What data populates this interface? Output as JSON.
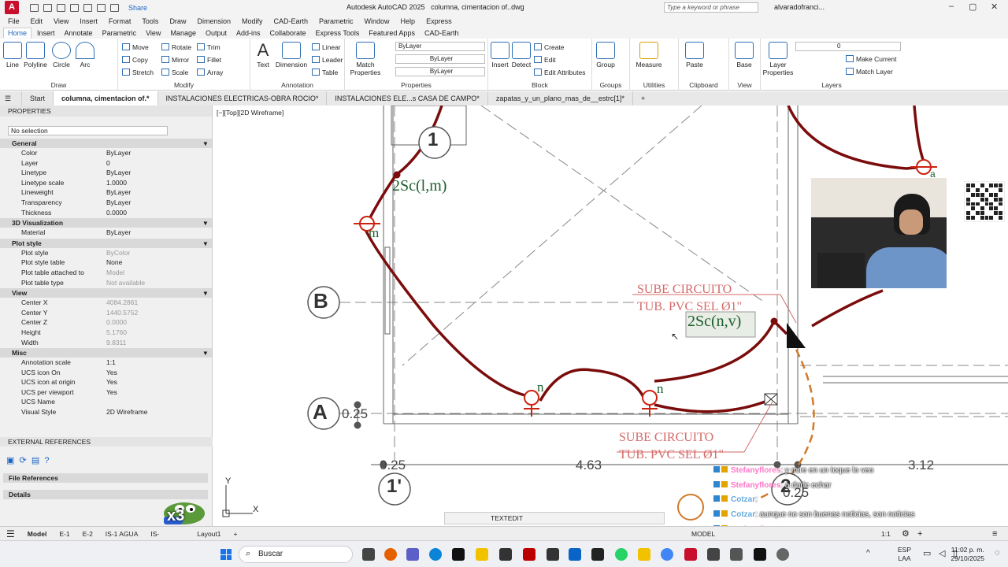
{
  "window": {
    "app_title": "Autodesk AutoCAD 2025",
    "file_title": "columna, cimentacion of..dwg",
    "search_placeholder": "Type a keyword or phrase",
    "user": "alvaradofranci...",
    "share": "Share"
  },
  "menu": [
    "File",
    "Edit",
    "View",
    "Insert",
    "Format",
    "Tools",
    "Draw",
    "Dimension",
    "Modify",
    "CAD-Earth",
    "Parametric",
    "Window",
    "Help",
    "Express"
  ],
  "ribbon_tabs": [
    "Home",
    "Insert",
    "Annotate",
    "Parametric",
    "View",
    "Manage",
    "Output",
    "Add-ins",
    "Collaborate",
    "Express Tools",
    "Featured Apps",
    "CAD-Earth"
  ],
  "active_ribbon_tab": "Home",
  "ribbon": {
    "draw": {
      "label": "Draw",
      "items": [
        "Line",
        "Polyline",
        "Circle",
        "Arc"
      ]
    },
    "modify": {
      "label": "Modify",
      "items": [
        "Move",
        "Rotate",
        "Trim",
        "Copy",
        "Mirror",
        "Fillet",
        "Stretch",
        "Scale",
        "Array"
      ]
    },
    "annotation": {
      "label": "Annotation",
      "items": [
        "Text",
        "Dimension",
        "Linear",
        "Leader",
        "Table"
      ]
    },
    "properties": {
      "label": "Properties",
      "match": "Match Properties",
      "dd1": "ByLayer",
      "dd2": "ByLayer",
      "dd3": "ByLayer"
    },
    "block": {
      "label": "Block",
      "items": [
        "Insert",
        "Detect",
        "Create",
        "Edit",
        "Edit Attributes"
      ]
    },
    "groups": {
      "label": "Groups",
      "item": "Group"
    },
    "utilities": {
      "label": "Utilities",
      "item": "Measure"
    },
    "clipboard": {
      "label": "Clipboard",
      "item": "Paste"
    },
    "view": {
      "label": "View",
      "item": "Base"
    },
    "layers": {
      "label": "Layers",
      "item": "Layer Properties",
      "current": "0",
      "make_current": "Make Current",
      "match_layer": "Match Layer"
    }
  },
  "doc_tabs": [
    "Start",
    "columna, cimentacion of.*",
    "INSTALACIONES ELECTRICAS-OBRA ROCIO*",
    "INSTALACIONES ELE...s CASA DE CAMPO*",
    "zapatas_y_un_plano_mas_de__estrc[1]*"
  ],
  "active_doc_tab": "columna, cimentacion of.*",
  "properties_panel": {
    "title": "PROPERTIES",
    "selection": "No selection",
    "sections": [
      {
        "name": "General",
        "rows": [
          [
            "Color",
            "ByLayer"
          ],
          [
            "Layer",
            "0"
          ],
          [
            "Linetype",
            "ByLayer"
          ],
          [
            "Linetype scale",
            "1.0000"
          ],
          [
            "Lineweight",
            "ByLayer"
          ],
          [
            "Transparency",
            "ByLayer"
          ],
          [
            "Thickness",
            "0.0000"
          ]
        ]
      },
      {
        "name": "3D Visualization",
        "rows": [
          [
            "Material",
            "ByLayer"
          ]
        ]
      },
      {
        "name": "Plot style",
        "rows": [
          [
            "Plot style",
            "ByColor"
          ],
          [
            "Plot style table",
            "None"
          ],
          [
            "Plot table attached to",
            "Model"
          ],
          [
            "Plot table type",
            "Not available"
          ]
        ]
      },
      {
        "name": "View",
        "rows": [
          [
            "Center X",
            "4084.2861"
          ],
          [
            "Center Y",
            "1440.5752"
          ],
          [
            "Center Z",
            "0.0000"
          ],
          [
            "Height",
            "5.1760"
          ],
          [
            "Width",
            "9.8311"
          ]
        ]
      },
      {
        "name": "Misc",
        "rows": [
          [
            "Annotation scale",
            "1:1"
          ],
          [
            "UCS icon On",
            "Yes"
          ],
          [
            "UCS icon at origin",
            "Yes"
          ],
          [
            "UCS per viewport",
            "Yes"
          ],
          [
            "UCS Name",
            ""
          ],
          [
            "Visual Style",
            "2D Wireframe"
          ]
        ]
      }
    ],
    "external_refs": "EXTERNAL REFERENCES",
    "file_references": "File References",
    "details": "Details"
  },
  "viewport_label": "[−][Top][2D Wireframe]",
  "drawing": {
    "labels": {
      "axis_1": "1",
      "axis_1p": "1'",
      "axis_2": "2",
      "axis_b": "B",
      "axis_a": "A",
      "circuit_lm": "2Sc(l,m)",
      "circuit_nv": "2Sc(n,v)",
      "sube1_a": "SUBE CIRCUITO",
      "sube1_b": "TUB. PVC SEL Ø1\"",
      "sube2_a": "SUBE CIRCUITO",
      "sube2_b": "TUB. PVC SEL Ø1\"",
      "dim_025a": "0.25",
      "dim_025b": "0.25",
      "dim_025c": "0.25",
      "dim_463": "4.63",
      "dim_312": "3.12",
      "m": "m",
      "n1": "n",
      "n2": "n",
      "a": "a",
      "ucs_x": "X",
      "ucs_y": "Y"
    }
  },
  "command_line": "TEXTEDIT",
  "status": {
    "layouts": [
      "Model",
      "E-1",
      "E-2",
      "IS-1 AGUA",
      "IS-",
      "Layout1"
    ],
    "active_layout": "Model",
    "model_label": "MODEL",
    "scale": "1:1"
  },
  "chat": [
    {
      "user": "Stefanyflores",
      "text": ": y mire en un toque lo veo"
    },
    {
      "user": "Stefanyflores",
      "text": ": a darle echar"
    },
    {
      "user": "Cotzar",
      "text": ": "
    },
    {
      "user": "Cotzar",
      "text": ": aunque no son buenas noticias, son noticias"
    },
    {
      "user": "Stefanyflores",
      "text": ": "
    },
    {
      "user": "Cotzar",
      "text": ": "
    },
    {
      "user": "Cotzar",
      "text": ": "
    }
  ],
  "taskbar": {
    "search": "Buscar",
    "lang": "ESP",
    "lang2": "LAA",
    "time": "11:02 p. m.",
    "date": "29/10/2025"
  },
  "emote": "x3",
  "colors": {
    "circuit": "#7a0c0c",
    "text_red": "#d46a6a",
    "text_green": "#1c5e2c",
    "accent": "#1a66c4"
  }
}
